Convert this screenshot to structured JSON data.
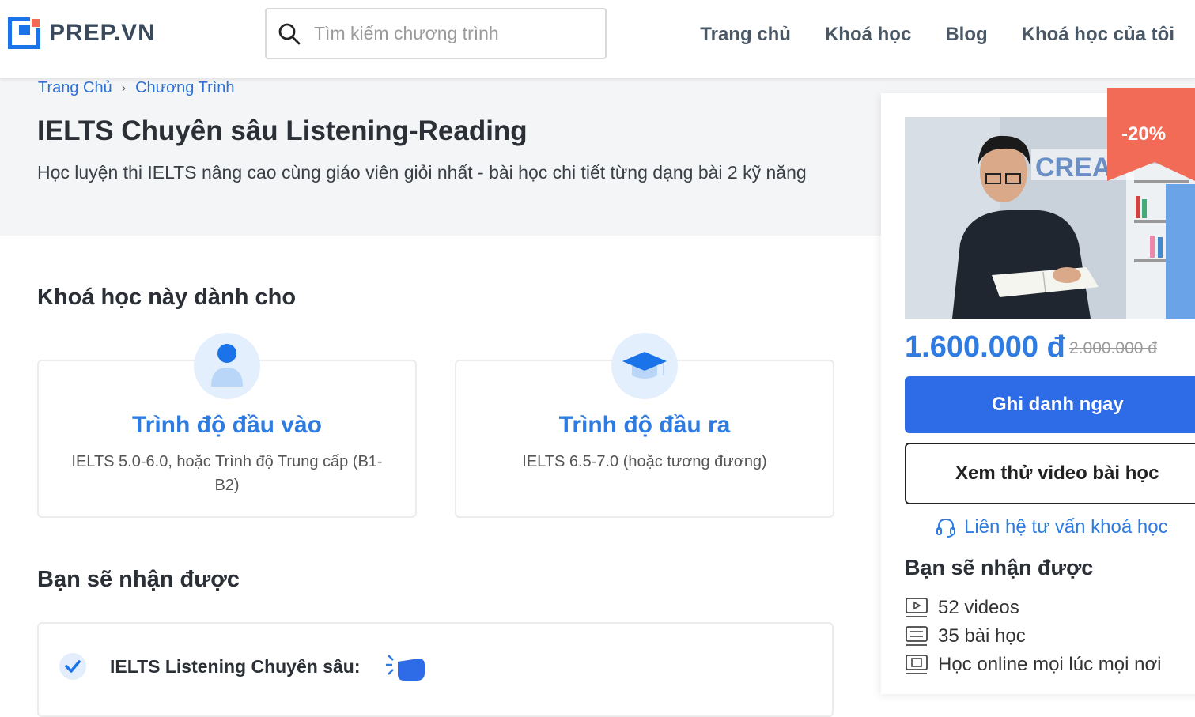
{
  "header": {
    "logo_text": "PREP.VN",
    "search_placeholder": "Tìm kiếm chương trình",
    "nav": [
      "Trang chủ",
      "Khoá học",
      "Blog",
      "Khoá học của tôi"
    ]
  },
  "breadcrumb": [
    "Trang Chủ",
    "Chương Trình"
  ],
  "hero": {
    "title": "IELTS Chuyên sâu Listening-Reading",
    "subtitle": "Học luyện thi IELTS nâng cao cùng giáo viên giỏi nhất - bài học chi tiết từng dạng bài 2 kỹ năng"
  },
  "audience": {
    "title": "Khoá học này dành cho",
    "cards": [
      {
        "title": "Trình độ đầu vào",
        "desc": "IELTS 5.0-6.0, hoặc Trình độ Trung cấp (B1-B2)",
        "icon": "user-icon"
      },
      {
        "title": "Trình độ đầu ra",
        "desc": "IELTS 6.5-7.0 (hoặc tương đương)",
        "icon": "graduation-cap-icon"
      }
    ]
  },
  "benefits": {
    "title": "Bạn sẽ nhận được",
    "items": [
      "IELTS Listening Chuyên sâu:"
    ]
  },
  "side": {
    "discount": "-20%",
    "price": "1.600.000 đ",
    "old_price": "2.000.000 đ",
    "enroll_label": "Ghi danh ngay",
    "preview_label": "Xem thử video bài học",
    "contact_label": "Liên hệ tư vấn khoá học",
    "includes_title": "Bạn sẽ nhận được",
    "includes": [
      "52 videos",
      "35 bài học",
      "Học online mọi lúc mọi nơi"
    ]
  },
  "colors": {
    "primary": "#2e6be6",
    "accent_blue": "#2e7be2",
    "discount_red": "#f26b57",
    "hero_bg": "#f4f5f7"
  }
}
